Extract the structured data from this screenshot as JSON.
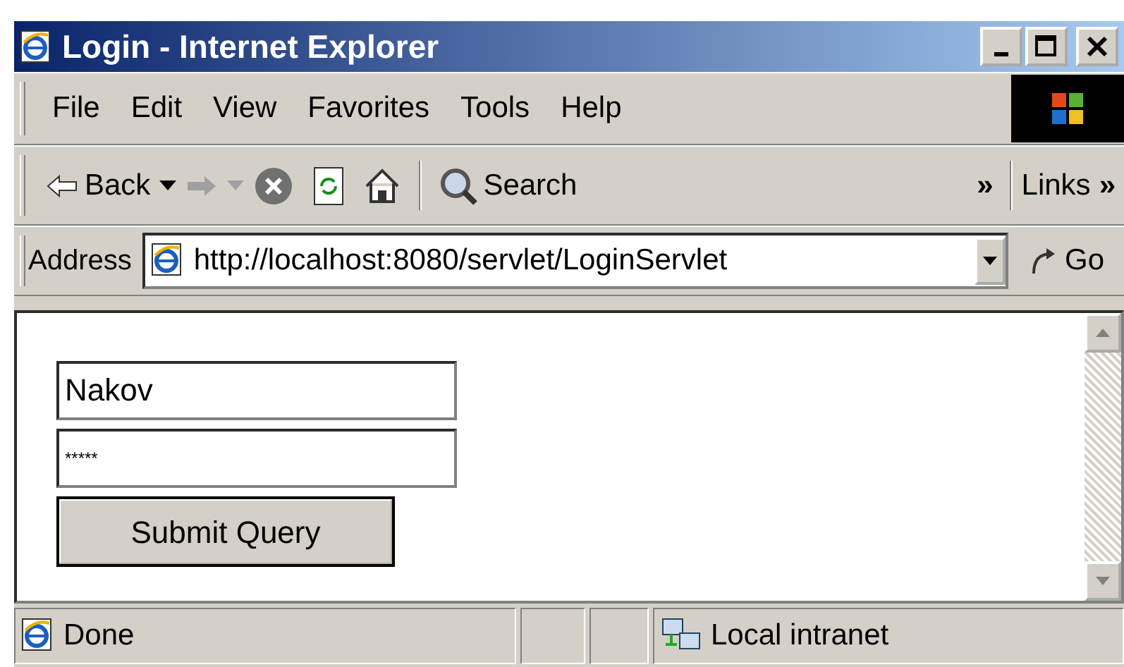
{
  "window": {
    "title": "Login - Internet Explorer"
  },
  "menu": [
    "File",
    "Edit",
    "View",
    "Favorites",
    "Tools",
    "Help"
  ],
  "toolbar": {
    "back": {
      "label": "Back"
    },
    "forward": {
      "disabled": true
    },
    "search": {
      "label": "Search"
    },
    "more": "»",
    "links": "Links",
    "links_more": "»"
  },
  "address_bar": {
    "label": "Address",
    "url": "http://localhost:8080/servlet/LoginServlet",
    "go": "Go"
  },
  "form": {
    "username": "Nakov",
    "password": "*****",
    "submit": "Submit Query"
  },
  "status_bar": {
    "text": "Done",
    "zone": "Local intranet"
  }
}
